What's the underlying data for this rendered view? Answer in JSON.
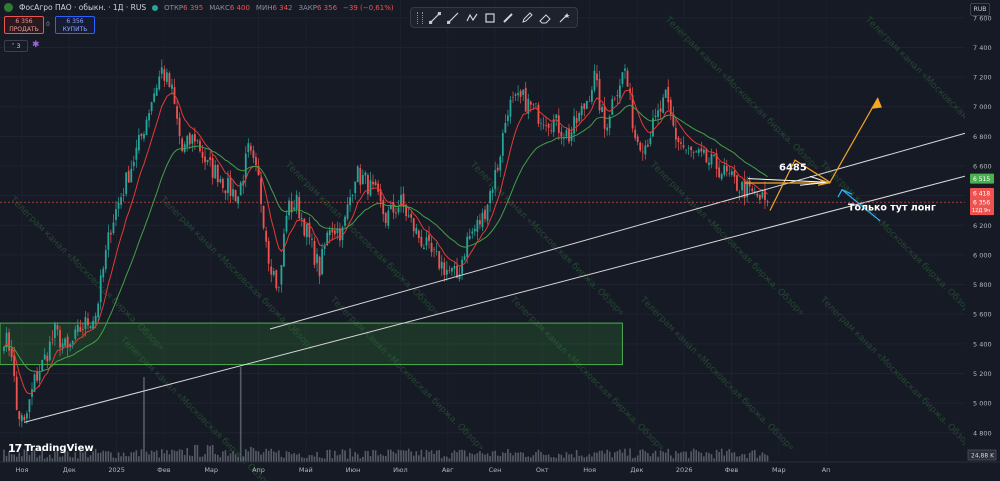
{
  "symbol": {
    "title": "ФосАгро ПАО · обыкн. · 1Д · RUS",
    "ohlc": [
      {
        "k": "ОТКР",
        "v": "6 395"
      },
      {
        "k": "МАКС",
        "v": "6 400"
      },
      {
        "k": "МИН",
        "v": "6 342"
      },
      {
        "k": "ЗАКР",
        "v": "6 356"
      },
      {
        "k": "",
        "v": "−39 (−0,61%)"
      }
    ]
  },
  "trade": {
    "sell_price": "6 356",
    "sell_label": "ПРОДАТЬ",
    "spread": "0",
    "buy_price": "6 356",
    "buy_label": "КУПИТЬ"
  },
  "indicators_count": "3",
  "currency": "RUB",
  "toolbar": {
    "tools": [
      "trend-line-tool",
      "ray-tool",
      "polyline-tool",
      "path-tool",
      "rectangle-tool",
      "brush-tool",
      "pencil-tool",
      "eraser-tool"
    ]
  },
  "branding": {
    "mark": "17",
    "name": "TradingView"
  },
  "watermark_text": "Телеграм канал «Московская биржа. Обзор»",
  "colors": {
    "background": "#161a25",
    "up": "#26a69a",
    "down": "#ef5350",
    "ema_fast": "#e53935",
    "ema_slow": "#43a047",
    "zone": "#2e7d32",
    "trendline": "#d9d9d9",
    "projection": "#f5a623",
    "arrow_blue": "#29b6f6",
    "last_price": "#ef5350",
    "level_green": "#4caf50"
  },
  "chart_data": {
    "type": "candlestick",
    "x_labels": [
      "Ноя",
      "Дек",
      "2025",
      "Фев",
      "Мар",
      "Апр",
      "Май",
      "Июн",
      "Июл",
      "Авг",
      "Сен",
      "Окт",
      "Ноя",
      "Дек",
      "2026",
      "Фев",
      "Мар",
      "Ап"
    ],
    "y_ticks": [
      4800,
      5000,
      5200,
      5400,
      5600,
      5800,
      6000,
      6200,
      6400,
      6600,
      6800,
      7000,
      7200,
      7400,
      7600
    ],
    "ylim": [
      4650,
      7720
    ],
    "price_anchors": [
      [
        0,
        5450
      ],
      [
        3,
        5350
      ],
      [
        5,
        4950
      ],
      [
        8,
        4850
      ],
      [
        12,
        5150
      ],
      [
        16,
        5300
      ],
      [
        20,
        5480
      ],
      [
        25,
        5350
      ],
      [
        30,
        5500
      ],
      [
        36,
        5600
      ],
      [
        42,
        6200
      ],
      [
        48,
        6500
      ],
      [
        54,
        6800
      ],
      [
        58,
        7050
      ],
      [
        62,
        7250
      ],
      [
        66,
        7100
      ],
      [
        70,
        6700
      ],
      [
        75,
        6800
      ],
      [
        80,
        6600
      ],
      [
        84,
        6550
      ],
      [
        88,
        6450
      ],
      [
        92,
        6400
      ],
      [
        96,
        6700
      ],
      [
        100,
        6500
      ],
      [
        104,
        6000
      ],
      [
        108,
        5750
      ],
      [
        111,
        6300
      ],
      [
        115,
        6350
      ],
      [
        120,
        6100
      ],
      [
        124,
        5900
      ],
      [
        128,
        6200
      ],
      [
        133,
        6150
      ],
      [
        138,
        6550
      ],
      [
        142,
        6500
      ],
      [
        146,
        6400
      ],
      [
        150,
        6250
      ],
      [
        156,
        6350
      ],
      [
        162,
        6150
      ],
      [
        168,
        6000
      ],
      [
        174,
        5900
      ],
      [
        178,
        5850
      ],
      [
        182,
        6100
      ],
      [
        188,
        6250
      ],
      [
        194,
        6600
      ],
      [
        198,
        7000
      ],
      [
        204,
        7050
      ],
      [
        210,
        6950
      ],
      [
        216,
        6900
      ],
      [
        222,
        6800
      ],
      [
        228,
        7000
      ],
      [
        232,
        7200
      ],
      [
        236,
        6850
      ],
      [
        240,
        7100
      ],
      [
        244,
        7250
      ],
      [
        248,
        6800
      ],
      [
        252,
        6750
      ],
      [
        256,
        6900
      ],
      [
        260,
        7050
      ],
      [
        264,
        6800
      ],
      [
        268,
        6700
      ],
      [
        274,
        6650
      ],
      [
        280,
        6600
      ],
      [
        286,
        6500
      ],
      [
        290,
        6450
      ],
      [
        295,
        6400
      ],
      [
        300,
        6350
      ]
    ],
    "volume_spikes": [
      [
        55,
        5
      ],
      [
        93,
        7
      ]
    ],
    "last_price": 6356,
    "last_change": "−39 (−0,61%)",
    "level_labels": [
      {
        "value": 6515,
        "text": "6 515",
        "kind": "green"
      },
      {
        "value": 6418,
        "text": "6 418",
        "kind": "red"
      },
      {
        "value": 6356,
        "text": "6 356",
        "kind": "price",
        "sub": "12Д 9ч"
      }
    ],
    "volume_label": "24,88 K",
    "demand_zone": {
      "from": 5260,
      "to": 5540,
      "x_start": 0,
      "x_end": 0.645
    },
    "annotations": [
      {
        "type": "text",
        "text": "6485",
        "color": "#ffffff"
      },
      {
        "type": "text",
        "text": "Только тут лонг",
        "color": "#ffffff"
      }
    ]
  }
}
